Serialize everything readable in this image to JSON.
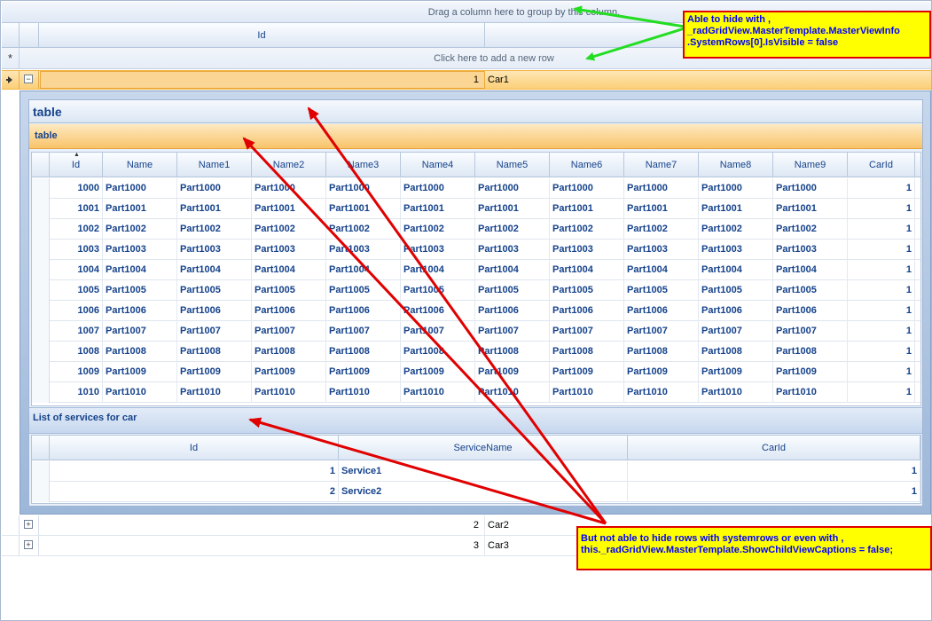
{
  "group_panel": {
    "text": "Drag a column here to group by this column."
  },
  "master": {
    "columns": [
      "Id",
      ""
    ],
    "new_row_text": "Click here to add a new row",
    "new_row_indicator": "*",
    "rows": [
      {
        "id": "1",
        "name": "Car1"
      },
      {
        "id": "2",
        "name": "Car2"
      },
      {
        "id": "3",
        "name": "Car3"
      }
    ]
  },
  "detail": {
    "caption": "table",
    "sub_caption": "table",
    "parts_columns": [
      "Id",
      "Name",
      "Name1",
      "Name2",
      "Name3",
      "Name4",
      "Name5",
      "Name6",
      "Name7",
      "Name8",
      "Name9",
      "CarId"
    ],
    "parts_rows": [
      [
        "1000",
        "Part1000",
        "Part1000",
        "Part1000",
        "Part1000",
        "Part1000",
        "Part1000",
        "Part1000",
        "Part1000",
        "Part1000",
        "Part1000",
        "1"
      ],
      [
        "1001",
        "Part1001",
        "Part1001",
        "Part1001",
        "Part1001",
        "Part1001",
        "Part1001",
        "Part1001",
        "Part1001",
        "Part1001",
        "Part1001",
        "1"
      ],
      [
        "1002",
        "Part1002",
        "Part1002",
        "Part1002",
        "Part1002",
        "Part1002",
        "Part1002",
        "Part1002",
        "Part1002",
        "Part1002",
        "Part1002",
        "1"
      ],
      [
        "1003",
        "Part1003",
        "Part1003",
        "Part1003",
        "Part1003",
        "Part1003",
        "Part1003",
        "Part1003",
        "Part1003",
        "Part1003",
        "Part1003",
        "1"
      ],
      [
        "1004",
        "Part1004",
        "Part1004",
        "Part1004",
        "Part1004",
        "Part1004",
        "Part1004",
        "Part1004",
        "Part1004",
        "Part1004",
        "Part1004",
        "1"
      ],
      [
        "1005",
        "Part1005",
        "Part1005",
        "Part1005",
        "Part1005",
        "Part1005",
        "Part1005",
        "Part1005",
        "Part1005",
        "Part1005",
        "Part1005",
        "1"
      ],
      [
        "1006",
        "Part1006",
        "Part1006",
        "Part1006",
        "Part1006",
        "Part1006",
        "Part1006",
        "Part1006",
        "Part1006",
        "Part1006",
        "Part1006",
        "1"
      ],
      [
        "1007",
        "Part1007",
        "Part1007",
        "Part1007",
        "Part1007",
        "Part1007",
        "Part1007",
        "Part1007",
        "Part1007",
        "Part1007",
        "Part1007",
        "1"
      ],
      [
        "1008",
        "Part1008",
        "Part1008",
        "Part1008",
        "Part1008",
        "Part1008",
        "Part1008",
        "Part1008",
        "Part1008",
        "Part1008",
        "Part1008",
        "1"
      ],
      [
        "1009",
        "Part1009",
        "Part1009",
        "Part1009",
        "Part1009",
        "Part1009",
        "Part1009",
        "Part1009",
        "Part1009",
        "Part1009",
        "Part1009",
        "1"
      ],
      [
        "1010",
        "Part1010",
        "Part1010",
        "Part1010",
        "Part1010",
        "Part1010",
        "Part1010",
        "Part1010",
        "Part1010",
        "Part1010",
        "Part1010",
        "1"
      ]
    ],
    "services_caption": "List of services for car",
    "services_columns": [
      "Id",
      "ServiceName",
      "CarId"
    ],
    "services_rows": [
      [
        "1",
        "Service1",
        "1"
      ],
      [
        "2",
        "Service2",
        "1"
      ]
    ]
  },
  "annotations": {
    "note1": [
      "Able to hide with ,",
      "_radGridView.MasterTemplate.MasterViewInfo",
      ".SystemRows[0].IsVisible = false"
    ],
    "note2": [
      "But not able to hide rows with systemrows or even with ,",
      "this._radGridView.MasterTemplate.ShowChildViewCaptions = false;"
    ]
  },
  "colors": {
    "header_text": "#15428b",
    "selected_row": "#fbcf77",
    "note_fill": "#ffff00",
    "note_border": "#e00000",
    "note_text": "#0000ff",
    "arrow_green": "#22dd22",
    "arrow_red": "#e00000"
  },
  "icons": {
    "current_row": "arrow-right-icon",
    "expand": "plus-box-icon",
    "collapse": "minus-box-icon",
    "sort": "sort-ascending-icon"
  }
}
